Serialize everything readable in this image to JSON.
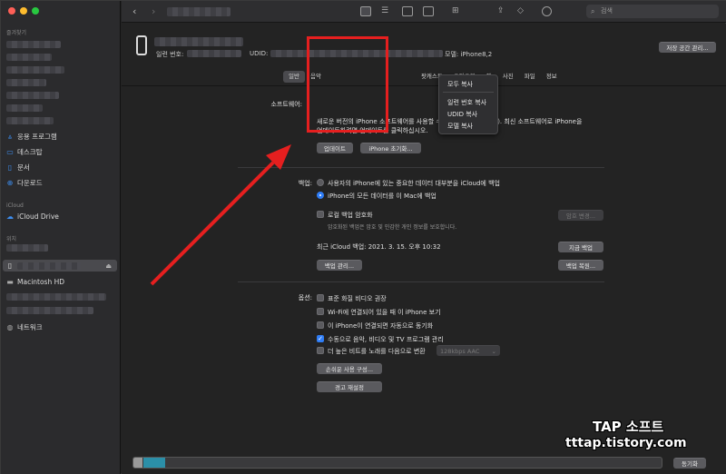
{
  "sidebar": {
    "sections": {
      "favorites": "즐겨찾기",
      "icloud": "iCloud",
      "locations": "위치"
    },
    "items": [
      {
        "label": "응용 프로그램",
        "icon": "apps-icon"
      },
      {
        "label": "데스크탑",
        "icon": "desktop-icon"
      },
      {
        "label": "문서",
        "icon": "document-icon"
      },
      {
        "label": "다운로드",
        "icon": "download-icon"
      },
      {
        "label": "iCloud Drive",
        "icon": "cloud-icon"
      },
      {
        "label": "Macintosh HD",
        "icon": "disk-icon"
      },
      {
        "label": "네트워크",
        "icon": "network-icon"
      }
    ]
  },
  "toolbar": {
    "search_placeholder": "검색",
    "back": "‹",
    "forward": "›"
  },
  "device": {
    "serial_label": "일련 번호:",
    "udid_label": "UDID:",
    "model_label": "모델: iPhone8,2",
    "manage_storage": "저장 공간 관리..."
  },
  "tabs": [
    "일반",
    "음악",
    "",
    "",
    "",
    "",
    "팟캐스트",
    "오디오북",
    "책",
    "사진",
    "파일",
    "정보"
  ],
  "popup_menu": [
    "모두 복사",
    "일련 번호 복사",
    "UDID 복사",
    "모델 복사"
  ],
  "software": {
    "label": "소프트웨어:",
    "message_line1": "새로운 버전의 iPhone 소프트웨어를 사용할 수 있습니다(버전 14.6). 최신 소프트웨어로 iPhone을",
    "message_line2": "업데이트하려면 업데이트를 클릭하십시오.",
    "update_button": "업데이트",
    "restore_button": "iPhone 초기화..."
  },
  "backup": {
    "label": "백업:",
    "option_icloud": "사용자의 iPhone에 있는 중요한 데이터 대부분을 iCloud에 백업",
    "option_mac": "iPhone의 모든 데이터를 이 Mac에 백업",
    "encrypt_label": "로컬 백업 암호화",
    "encrypt_note": "암호화된 백업은 암호 및 민감한 개인 정보를 보호합니다.",
    "change_password": "암호 변경...",
    "last_backup": "최근 iCloud 백업: 2021. 3. 15. 오후 10:32",
    "backup_now": "지금 백업",
    "manage_backups": "백업 관리...",
    "restore_backup": "백업 복원..."
  },
  "options": {
    "label": "옵션:",
    "items": [
      {
        "label": "표준 화질 비디오 권장",
        "checked": false
      },
      {
        "label": "Wi-Fi에 연결되어 있을 때 이 iPhone 보기",
        "checked": false
      },
      {
        "label": "이 iPhone이 연결되면 자동으로 동기화",
        "checked": false
      },
      {
        "label": "수동으로 음악, 비디오 및 TV 프로그램 관리",
        "checked": true
      },
      {
        "label": "더 높은 비트를 노래를 다음으로 변환",
        "checked": false
      }
    ],
    "bitrate_select": "128kbps AAC",
    "accessibility_button": "손쉬운 사용 구성...",
    "reset_warnings": "경고 재설정"
  },
  "footer": {
    "sync_button": "동기화"
  },
  "watermark": {
    "line1": "TAP 소프트",
    "line2": "tttap.tistory.com"
  },
  "colors": {
    "accent": "#2f7df6",
    "annotation_red": "#e51f1f"
  }
}
